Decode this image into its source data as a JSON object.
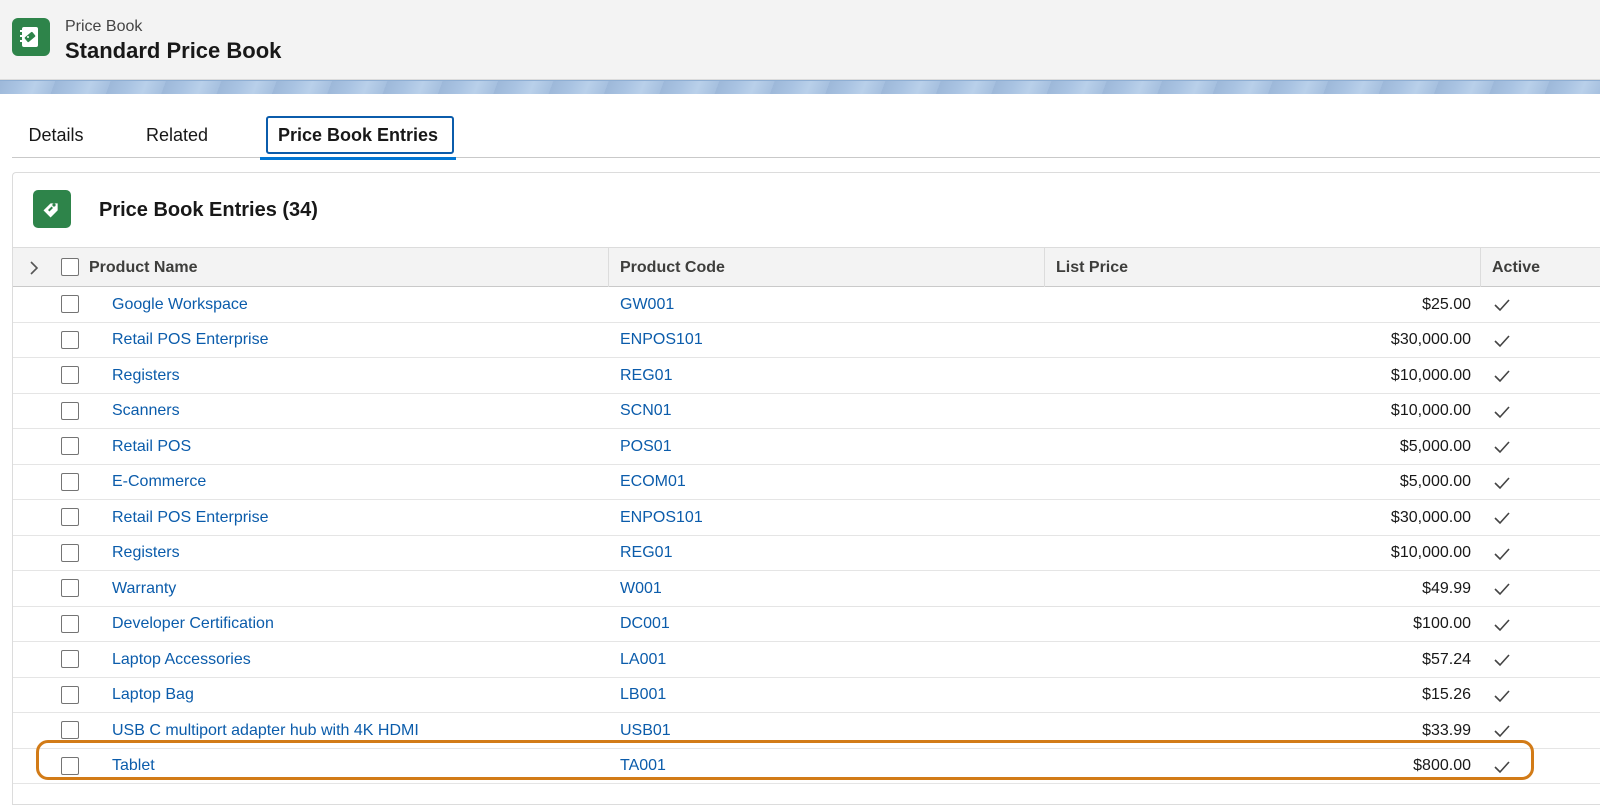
{
  "header": {
    "eyebrow": "Price Book",
    "title": "Standard Price Book",
    "icon": "pricebook-icon"
  },
  "tabs": [
    {
      "label": "Details",
      "active": false
    },
    {
      "label": "Related",
      "active": false
    },
    {
      "label": "Price Book Entries",
      "active": true
    }
  ],
  "card": {
    "title": "Price Book Entries (34)",
    "icon": "price-tag-icon"
  },
  "table": {
    "columns": [
      "Product Name",
      "Product Code",
      "List Price",
      "Active"
    ],
    "rows": [
      {
        "name": "Google Workspace",
        "code": "GW001",
        "price": "$25.00",
        "active": true
      },
      {
        "name": "Retail POS Enterprise",
        "code": "ENPOS101",
        "price": "$30,000.00",
        "active": true
      },
      {
        "name": "Registers",
        "code": "REG01",
        "price": "$10,000.00",
        "active": true
      },
      {
        "name": "Scanners",
        "code": "SCN01",
        "price": "$10,000.00",
        "active": true
      },
      {
        "name": "Retail POS",
        "code": "POS01",
        "price": "$5,000.00",
        "active": true
      },
      {
        "name": "E-Commerce",
        "code": "ECOM01",
        "price": "$5,000.00",
        "active": true
      },
      {
        "name": "Retail POS Enterprise",
        "code": "ENPOS101",
        "price": "$30,000.00",
        "active": true
      },
      {
        "name": "Registers",
        "code": "REG01",
        "price": "$10,000.00",
        "active": true
      },
      {
        "name": "Warranty",
        "code": "W001",
        "price": "$49.99",
        "active": true
      },
      {
        "name": "Developer Certification",
        "code": "DC001",
        "price": "$100.00",
        "active": true
      },
      {
        "name": "Laptop Accessories",
        "code": "LA001",
        "price": "$57.24",
        "active": true
      },
      {
        "name": "Laptop Bag",
        "code": "LB001",
        "price": "$15.26",
        "active": true
      },
      {
        "name": "USB C multiport adapter hub with 4K HDMI",
        "code": "USB01",
        "price": "$33.99",
        "active": true
      },
      {
        "name": "Tablet",
        "code": "TA001",
        "price": "$800.00",
        "active": true
      }
    ]
  },
  "colors": {
    "brand_green": "#2e844a",
    "link_blue": "#0b5cab",
    "highlight_orange": "#d27b17"
  }
}
